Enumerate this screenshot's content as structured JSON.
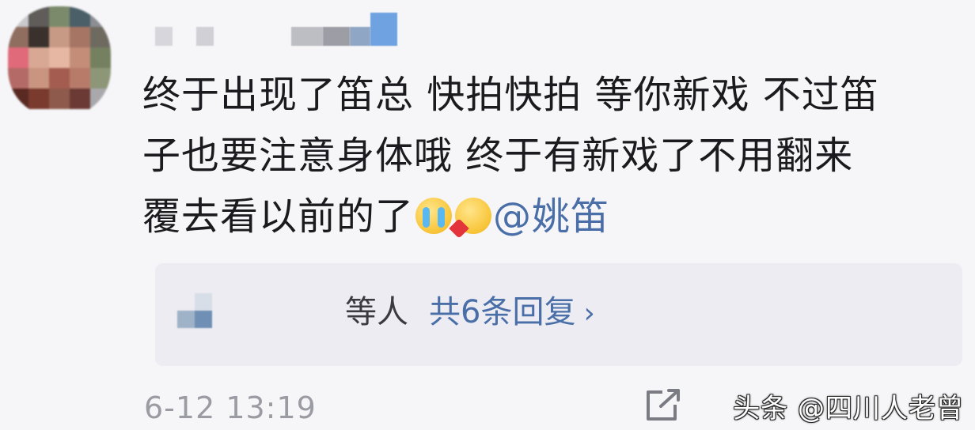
{
  "comment": {
    "line1": "终于出现了笛总 快拍快拍 等你新戏 不过笛",
    "line2": "子也要注意身体哦 终于有新戏了不用翻来",
    "line3_text": "覆去看以前的了",
    "emoji_1": "crying-face-emoji",
    "emoji_2": "blowing-kiss-emoji",
    "mention": "@姚笛"
  },
  "reply": {
    "names_suffix": "等人",
    "count_label": "共6条回复",
    "chevron": "›"
  },
  "footer": {
    "timestamp": "6-12 13:19",
    "share_icon": "share-icon"
  },
  "watermark": "头条 @四川人老曾",
  "colors": {
    "background": "#f6f6f8",
    "reply_box": "#ececf2",
    "link_blue": "#4a6fa8",
    "text": "#1b1b1f",
    "muted": "#9b9ba3"
  }
}
